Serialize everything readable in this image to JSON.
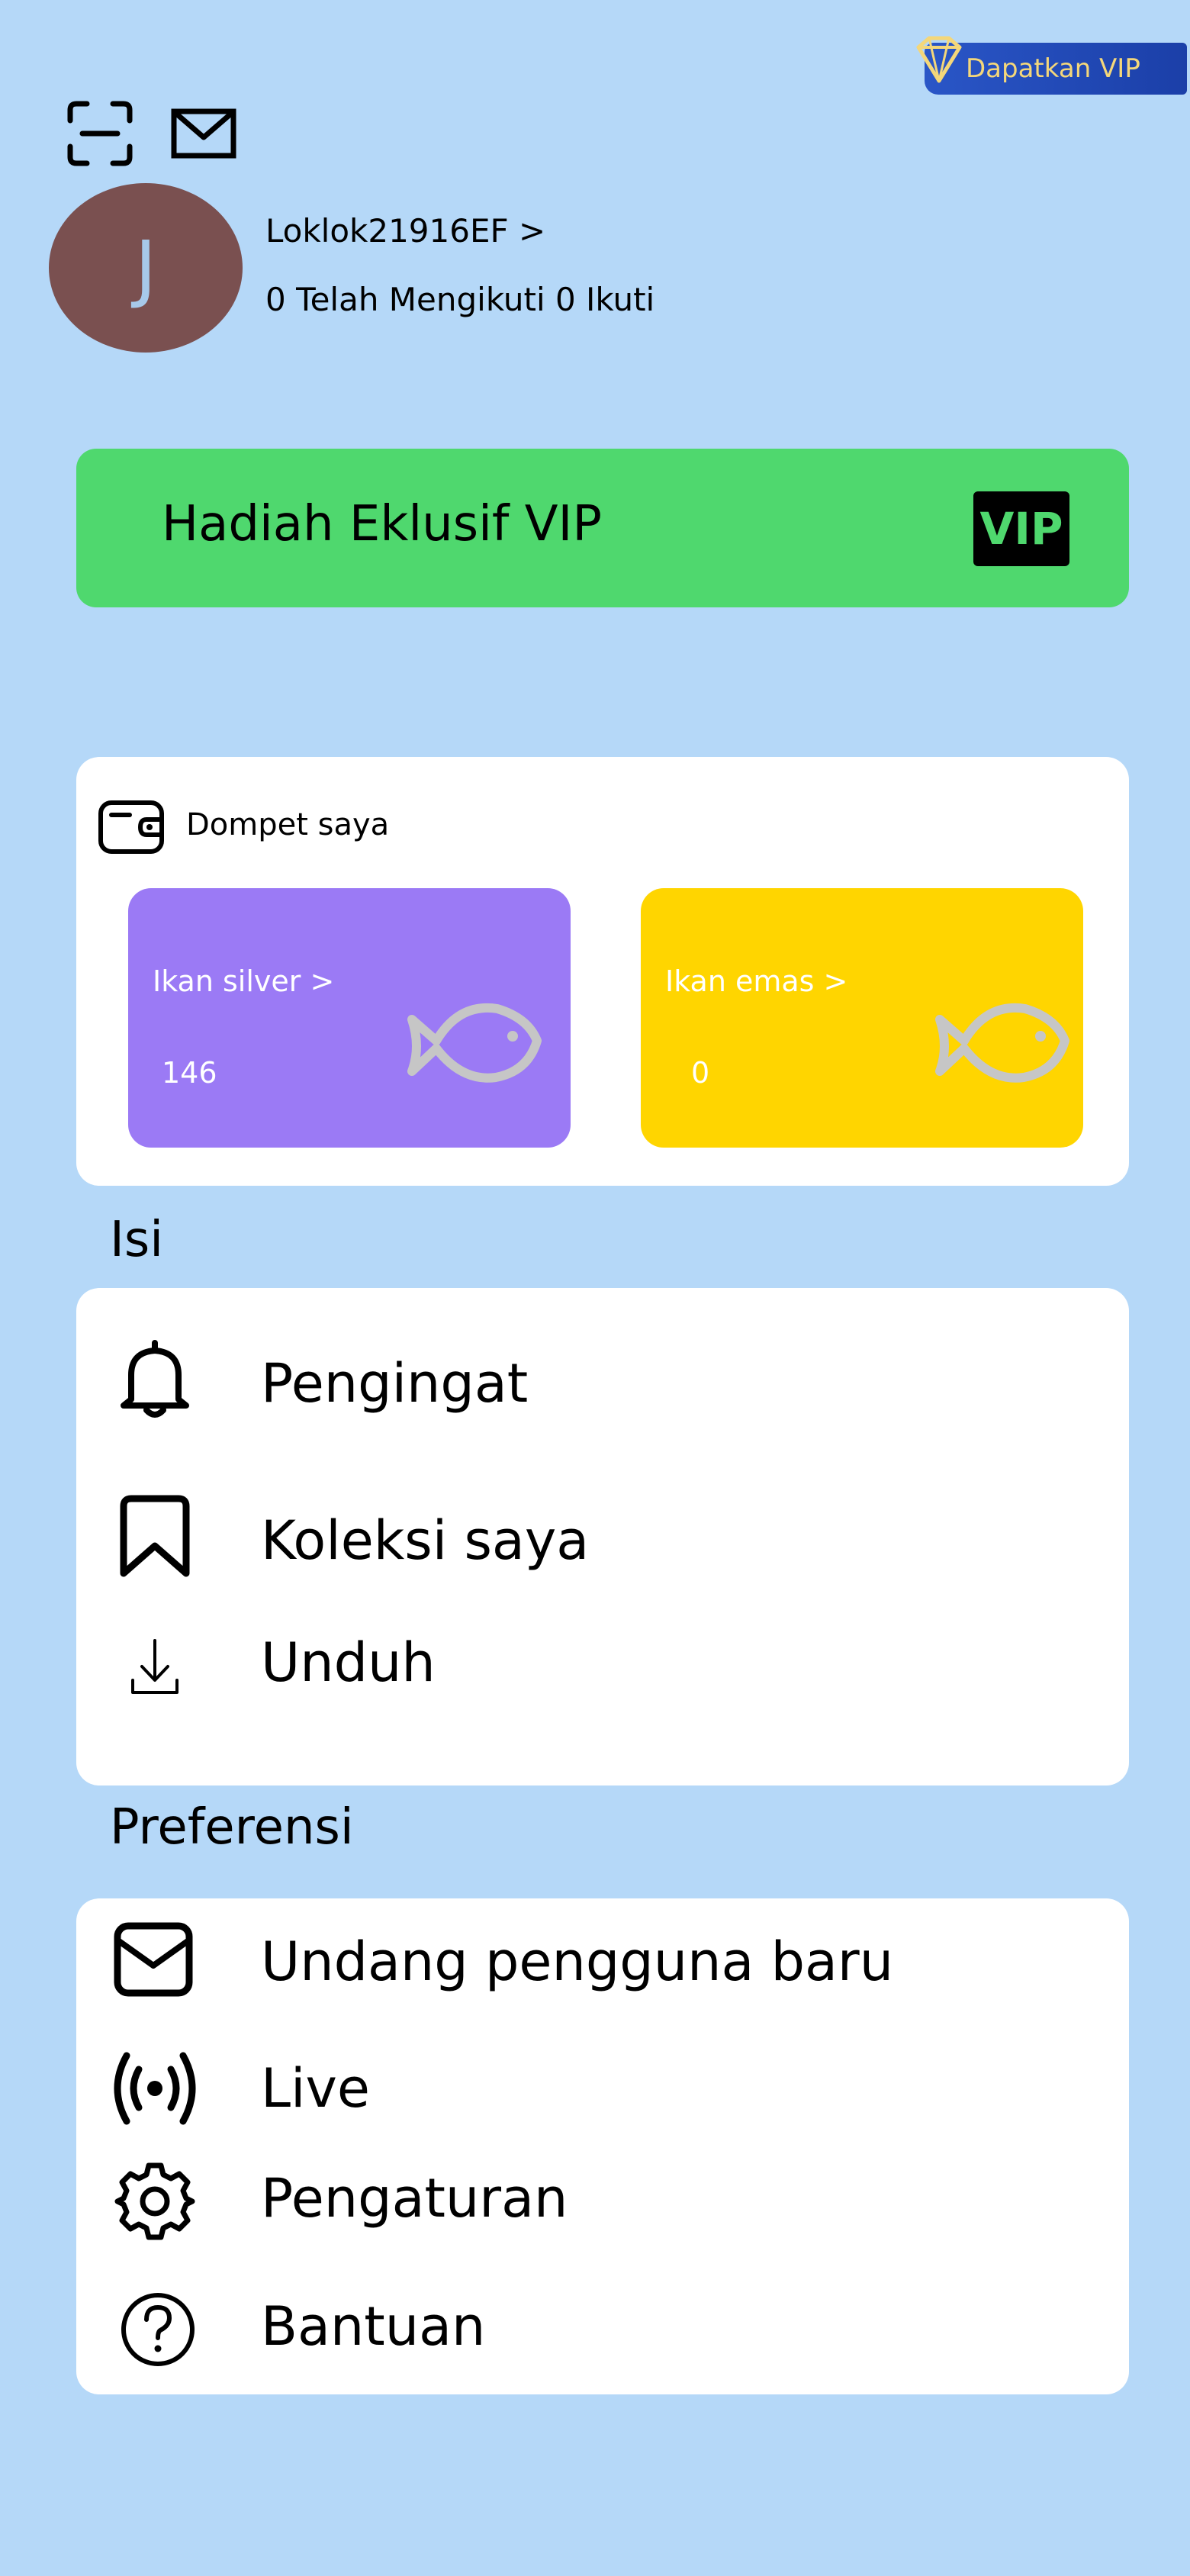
{
  "header": {
    "vip_badge_label": "Dapatkan VIP"
  },
  "profile": {
    "avatar_initial": "J",
    "username": "Loklok21916EF  >",
    "follow_stats": "0 Telah Mengikuti  0 Ikuti"
  },
  "vip_banner": {
    "title": "Hadiah Eklusif VIP",
    "tag": "VIP"
  },
  "wallet": {
    "title": "Dompet saya",
    "silver": {
      "label": "Ikan silver >",
      "value": "146"
    },
    "gold": {
      "label": "Ikan emas >",
      "value": "0"
    }
  },
  "sections": {
    "content_title": "Isi",
    "content_items": [
      "Pengingat",
      "Koleksi saya",
      "Unduh"
    ],
    "preferences_title": "Preferensi",
    "preference_items": [
      "Undang pengguna baru",
      "Live",
      "Pengaturan",
      "Bantuan"
    ]
  },
  "colors": {
    "background": "#b5d8f8",
    "vip_green": "#4fd86e",
    "silver_card": "#9b7af5",
    "gold_card": "#ffd500",
    "avatar": "#7a5050"
  },
  "icons": {
    "top": [
      "scan-icon",
      "mail-icon"
    ],
    "content": [
      "bell-icon",
      "bookmark-icon",
      "download-icon"
    ],
    "preferences": [
      "mail-icon",
      "broadcast-icon",
      "gear-icon",
      "help-icon"
    ]
  }
}
